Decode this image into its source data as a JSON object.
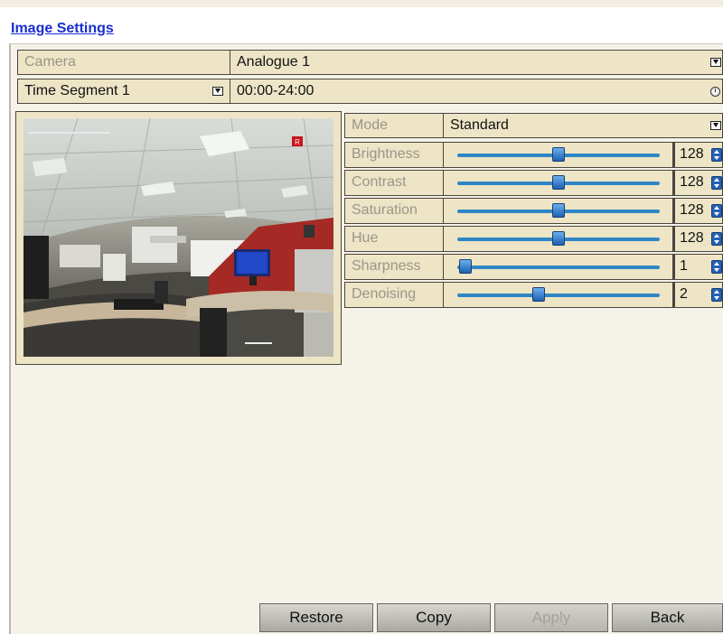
{
  "title": "Image Settings",
  "camera": {
    "label": "Camera",
    "value": "Analogue 1"
  },
  "time_segment": {
    "value": "Time Segment 1",
    "range": "00:00-24:00"
  },
  "mode": {
    "label": "Mode",
    "value": "Standard"
  },
  "sliders": [
    {
      "label": "Brightness",
      "value": "128",
      "fraction": 0.5
    },
    {
      "label": "Contrast",
      "value": "128",
      "fraction": 0.5
    },
    {
      "label": "Saturation",
      "value": "128",
      "fraction": 0.5
    },
    {
      "label": "Hue",
      "value": "128",
      "fraction": 0.5
    },
    {
      "label": "Sharpness",
      "value": "1",
      "fraction": 0.04
    },
    {
      "label": "Denoising",
      "value": "2",
      "fraction": 0.4
    }
  ],
  "preview": {
    "record_badge": "R"
  },
  "buttons": {
    "restore": "Restore",
    "copy": "Copy",
    "apply": "Apply",
    "back": "Back"
  },
  "colors": {
    "accent": "#2f86c6",
    "panel": "#ede5c6",
    "title": "#1a2fd0"
  }
}
